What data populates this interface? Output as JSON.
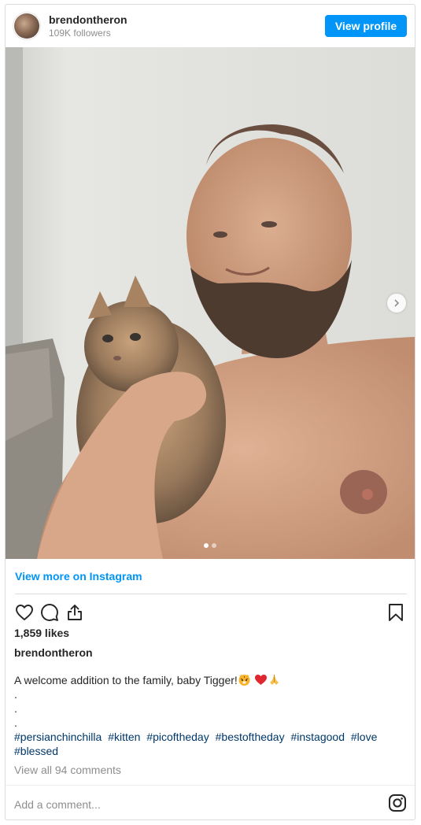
{
  "post": {
    "username": "brendontheron",
    "followers": "109K followers",
    "view_profile_label": "View profile",
    "view_more_label": "View more on Instagram",
    "likes": "1,859 likes",
    "author": "brendontheron",
    "caption_text": "A welcome addition to the family, baby Tigger!",
    "caption_dots": [
      ".",
      ".",
      "."
    ],
    "hashtags": [
      "#persianchinchilla",
      "#kitten",
      "#picoftheday",
      "#bestoftheday",
      "#instagood",
      "#love",
      "#blessed"
    ],
    "view_all_comments": "View all 94 comments",
    "comment_placeholder": "Add a comment...",
    "carousel": {
      "total": 2,
      "current": 1
    }
  },
  "icons": [
    "avatar",
    "heart-icon",
    "comment-icon",
    "share-icon",
    "bookmark-icon",
    "chevron-right-icon",
    "instagram-logo-icon",
    "tiger-face-emoji",
    "red-heart-emoji",
    "folded-hands-emoji"
  ],
  "colors": {
    "accent": "#0095f6",
    "hashtag": "#00376b",
    "muted": "#8e8e8e",
    "text": "#262626"
  }
}
